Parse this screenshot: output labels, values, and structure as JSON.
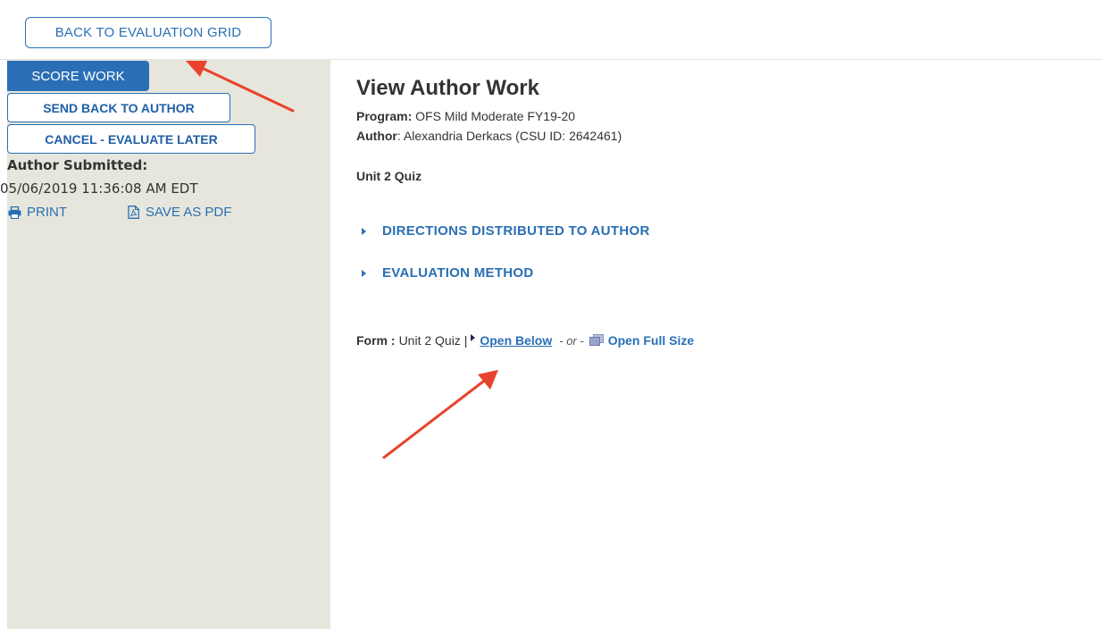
{
  "header": {
    "back_button_label": "BACK TO EVALUATION GRID"
  },
  "sidebar": {
    "score_button_label": "SCORE WORK",
    "send_back_button_label": "SEND BACK TO AUTHOR",
    "cancel_button_label": "CANCEL - EVALUATE LATER",
    "submitted_label": "Author Submitted:",
    "submitted_date": "05/06/2019 11:36:08 AM EDT",
    "print_label": "PRINT",
    "pdf_label": "SAVE AS PDF",
    "print_icon": "printer-icon",
    "pdf_icon": "pdf-file-icon"
  },
  "main": {
    "title": "View Author Work",
    "program_label": "Program:",
    "program_value": "OFS Mild Moderate FY19-20",
    "author_label": "Author",
    "author_value": ": Alexandria Derkacs (CSU ID: 2642461)",
    "quiz_title": "Unit 2 Quiz",
    "sections": [
      {
        "label": "DIRECTIONS DISTRIBUTED TO AUTHOR"
      },
      {
        "label": "EVALUATION METHOD"
      }
    ],
    "form": {
      "label": "Form :",
      "value": "Unit 2 Quiz |",
      "open_below_label": "Open Below",
      "or_text": "- or -",
      "open_full_label": "Open Full Size"
    }
  },
  "colors": {
    "accent": "#2a6fb5",
    "sidebar_bg": "#e7e6dc",
    "annotation_arrow": "#e8432e"
  }
}
